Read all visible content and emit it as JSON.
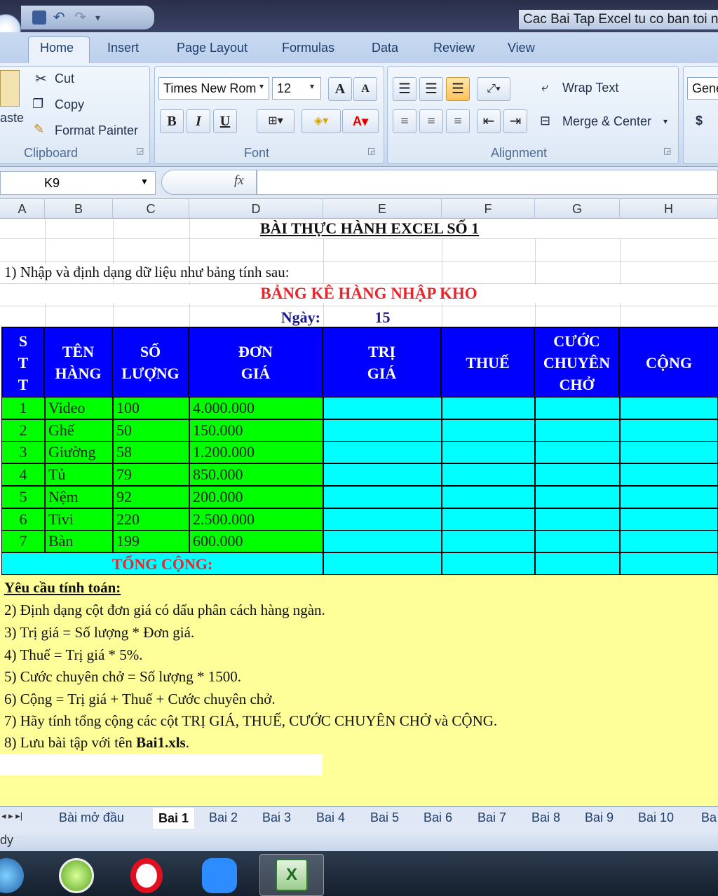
{
  "window": {
    "title": "Cac Bai Tap Excel tu co ban toi n"
  },
  "ribbon_tabs": [
    "Home",
    "Insert",
    "Page Layout",
    "Formulas",
    "Data",
    "Review",
    "View"
  ],
  "clipboard": {
    "paste_label": "aste",
    "cut": "Cut",
    "copy": "Copy",
    "format_painter": "Format Painter",
    "group_label": "Clipboard"
  },
  "font": {
    "name": "Times New Rom",
    "size": "12",
    "bold": "B",
    "italic": "I",
    "underline": "U",
    "grow": "A",
    "shrink": "A",
    "group_label": "Font"
  },
  "alignment": {
    "wrap_text": "Wrap Text",
    "merge_center": "Merge & Center",
    "group_label": "Alignment"
  },
  "number": {
    "format": "Gene",
    "currency": "$"
  },
  "formula_bar": {
    "name_box": "K9",
    "fx": "fx",
    "formula": ""
  },
  "columns": [
    "A",
    "B",
    "C",
    "D",
    "E",
    "F",
    "G",
    "H"
  ],
  "sheet": {
    "main_title": "BÀI THỰC HÀNH EXCEL SỐ 1",
    "instruction_1": "1) Nhập và định dạng dữ liệu như bảng tính sau:",
    "table_title": "BẢNG KÊ HÀNG NHẬP KHO",
    "date_label": "Ngày:",
    "date_value": "15",
    "headers": {
      "stt": [
        "S",
        "T",
        "T"
      ],
      "ten_hang": [
        "TÊN",
        "HÀNG"
      ],
      "so_luong": [
        "SỐ",
        "LƯỢNG"
      ],
      "don_gia": [
        "ĐƠN",
        "GIÁ"
      ],
      "tri_gia": [
        "TRỊ",
        "GIÁ"
      ],
      "thue": [
        "THUẾ"
      ],
      "cuoc": [
        "CƯỚC",
        "CHUYÊN",
        "CHỞ"
      ],
      "cong": [
        "CỘNG"
      ]
    },
    "rows": [
      {
        "stt": "1",
        "name": "Video",
        "qty": "100",
        "price": "4.000.000"
      },
      {
        "stt": "2",
        "name": "Ghế",
        "qty": "50",
        "price": "150.000"
      },
      {
        "stt": "3",
        "name": "Giường",
        "qty": "58",
        "price": "1.200.000"
      },
      {
        "stt": "4",
        "name": "Tủ",
        "qty": "79",
        "price": "850.000"
      },
      {
        "stt": "5",
        "name": "Nệm",
        "qty": "92",
        "price": "200.000"
      },
      {
        "stt": "6",
        "name": "Tivi",
        "qty": "220",
        "price": "2.500.000"
      },
      {
        "stt": "7",
        "name": "Bàn",
        "qty": "199",
        "price": "600.000"
      }
    ],
    "total_label": "TỔNG CỘNG:",
    "requirements_heading": "Yêu cầu tính toán:",
    "requirements": [
      "2) Định dạng cột đơn giá có dấu phân cách hàng ngàn.",
      "3) Trị giá = Số lượng * Đơn giá.",
      "4) Thuế = Trị giá * 5%.",
      "5) Cước chuyên chở = Số lượng * 1500.",
      "6) Cộng = Trị giá + Thuế + Cước chuyên chở.",
      "7) Hãy tính tổng cộng các cột TRỊ GIÁ, THUẾ, CƯỚC CHUYÊN CHỞ và CỘNG."
    ],
    "req_8_prefix": "8) Lưu bài tập với tên ",
    "req_8_file": "Bai1.xls",
    "req_8_suffix": "."
  },
  "sheet_tabs": [
    "Bài mở đầu",
    "Bai 1",
    "Bai 2",
    "Bai 3",
    "Bai 4",
    "Bai 5",
    "Bai 6",
    "Bai 7",
    "Bai 8",
    "Bai 9",
    "Bai 10",
    "Ba"
  ],
  "active_sheet": "Bai 1",
  "status": "dy",
  "colors": {
    "header_blue": "#0000ff",
    "data_green": "#00ff00",
    "calc_cyan": "#00ffff",
    "notes_yellow": "#ffff99",
    "title_red": "#e8262e",
    "date_navy": "#1a1a8c"
  }
}
